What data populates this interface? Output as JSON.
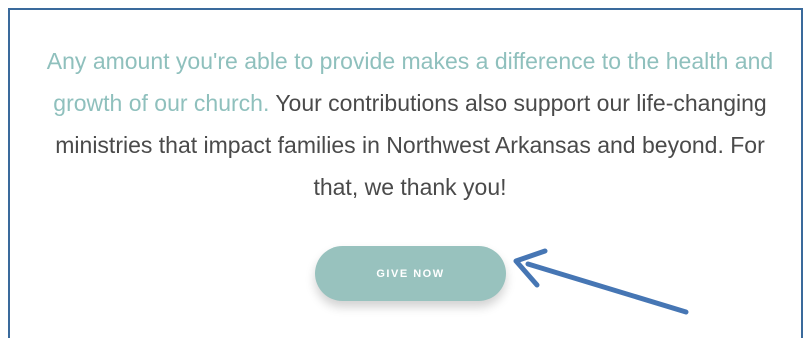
{
  "donation": {
    "message_highlight": "Any amount you're able to provide makes a difference to the health and growth of our church.",
    "message_body": " Your contributions also support our life-changing ministries that impact families in Northwest Arkansas and beyond. For that, we thank you!",
    "button_label": "GIVE NOW"
  },
  "colors": {
    "highlight_text": "#8fc0bd",
    "body_text": "#4a4a4a",
    "button_bg": "#98c2be",
    "frame_border": "#3a6a9c",
    "annotation_arrow": "#4676b4"
  },
  "icons": {
    "annotation": "arrow-icon"
  }
}
